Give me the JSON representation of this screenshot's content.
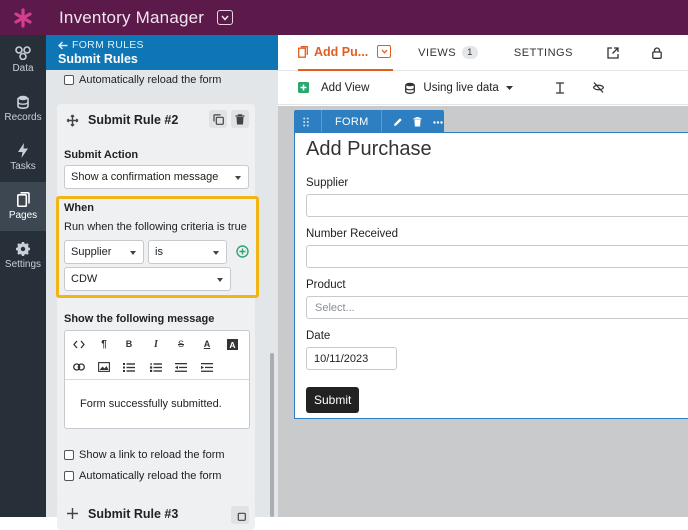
{
  "app": {
    "title": "Inventory Manager"
  },
  "nav": [
    {
      "label": "Data",
      "icon": "data-icon"
    },
    {
      "label": "Records",
      "icon": "records-icon"
    },
    {
      "label": "Tasks",
      "icon": "tasks-icon"
    },
    {
      "label": "Pages",
      "icon": "pages-icon"
    },
    {
      "label": "Settings",
      "icon": "settings-icon"
    }
  ],
  "panel": {
    "back_label": "FORM RULES",
    "title": "Submit Rules",
    "top_checkbox": "Automatically reload the form",
    "rule2": {
      "title": "Submit Rule #2",
      "action_label": "Submit Action",
      "action_value": "Show a confirmation message",
      "when_label": "When",
      "criteria_text": "Run when the following criteria is true",
      "field_value": "Supplier",
      "operator_value": "is",
      "value_value": "CDW",
      "message_label": "Show the following message",
      "message_text": "Form successfully submitted.",
      "cb_link": "Show a link to reload the form",
      "cb_reload": "Automatically reload the form"
    },
    "rule3": {
      "title": "Submit Rule #3"
    }
  },
  "main": {
    "tab_page": "Add Pu...",
    "tab_views": "VIEWS",
    "views_count": "1",
    "tab_settings": "SETTINGS",
    "add_view": "Add View",
    "live_data": "Using live data",
    "form_label": "FORM",
    "form_title": "Add Purchase",
    "fields": {
      "supplier": "Supplier",
      "number_received": "Number Received",
      "product": "Product",
      "product_placeholder": "Select...",
      "date": "Date",
      "date_value": "10/11/2023"
    },
    "submit": "Submit"
  },
  "colors": {
    "topbar": "#5b1a4a",
    "accent_orange": "#e35d1e",
    "blue": "#0f76b5",
    "highlight": "#f1b515",
    "green": "#2aa86f"
  }
}
